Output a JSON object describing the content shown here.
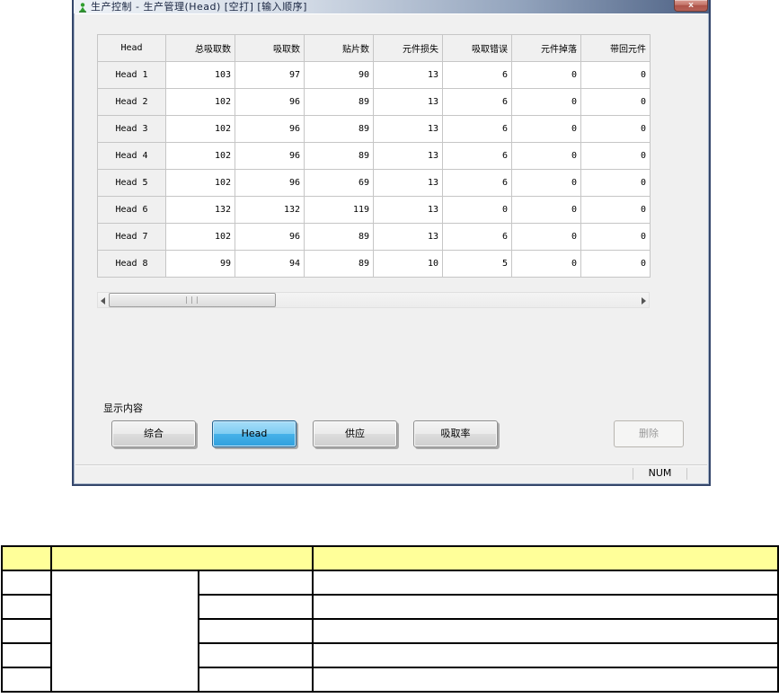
{
  "window": {
    "title": "生产控制  - 生产管理(Head) [空打] [输入顺序]",
    "close_label": "x",
    "status_bar": {
      "num_indicator": "NUM"
    }
  },
  "grid": {
    "columns": [
      "Head",
      "总吸取数",
      "吸取数",
      "贴片数",
      "元件损失",
      "吸取错误",
      "元件掉落",
      "带回元件"
    ],
    "rows": [
      {
        "head": "Head 1",
        "values": [
          103,
          97,
          90,
          13,
          6,
          0,
          0
        ]
      },
      {
        "head": "Head 2",
        "values": [
          102,
          96,
          89,
          13,
          6,
          0,
          0
        ]
      },
      {
        "head": "Head 3",
        "values": [
          102,
          96,
          89,
          13,
          6,
          0,
          0
        ]
      },
      {
        "head": "Head 4",
        "values": [
          102,
          96,
          89,
          13,
          6,
          0,
          0
        ]
      },
      {
        "head": "Head 5",
        "values": [
          102,
          96,
          69,
          13,
          6,
          0,
          0
        ]
      },
      {
        "head": "Head 6",
        "values": [
          132,
          132,
          119,
          13,
          0,
          0,
          0
        ]
      },
      {
        "head": "Head 7",
        "values": [
          102,
          96,
          89,
          13,
          6,
          0,
          0
        ]
      },
      {
        "head": "Head 8",
        "values": [
          99,
          94,
          89,
          10,
          5,
          0,
          0
        ]
      }
    ],
    "selected_cell": {
      "row": "Head 1",
      "column": "总吸取数",
      "value": 103
    }
  },
  "display_section": {
    "label": "显示内容",
    "buttons": [
      {
        "label": "综合",
        "state": "normal"
      },
      {
        "label": "Head",
        "state": "selected"
      },
      {
        "label": "供应",
        "state": "normal"
      },
      {
        "label": "吸取率",
        "state": "normal"
      }
    ],
    "delete_button": {
      "label": "删除",
      "state": "disabled"
    }
  },
  "scrollbar": {
    "orientation": "horizontal",
    "grip": "|||"
  },
  "bottom_table": {
    "header_color": "#ffff99",
    "border_color": "#000000",
    "columns": 4,
    "body_rows": 5,
    "all_cells_empty": true
  },
  "colors": {
    "titlebar_gradient_left": "#eef2f7",
    "titlebar_gradient_right": "#4d6184",
    "close_button_red": "#ad5348",
    "selected_button_blue": "#47b2e9",
    "window_chrome": "#34466b",
    "client_background": "#f0f0f0",
    "grid_line": "#c6c6c6"
  }
}
